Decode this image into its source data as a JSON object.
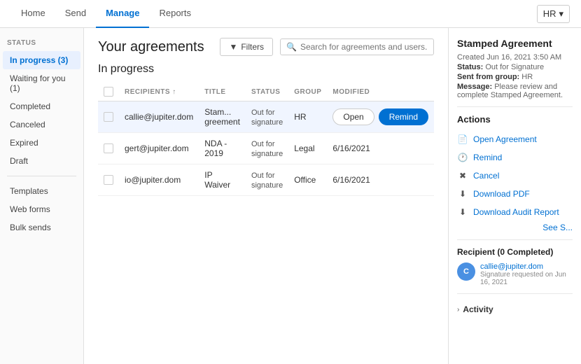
{
  "nav": {
    "items": [
      {
        "label": "Home",
        "active": false
      },
      {
        "label": "Send",
        "active": false
      },
      {
        "label": "Manage",
        "active": true
      },
      {
        "label": "Reports",
        "active": false
      }
    ],
    "user_btn": "HR"
  },
  "sidebar": {
    "status_label": "STATUS",
    "status_items": [
      {
        "label": "In progress (3)",
        "active": true
      },
      {
        "label": "Waiting for you (1)",
        "active": false
      },
      {
        "label": "Completed",
        "active": false
      },
      {
        "label": "Canceled",
        "active": false
      },
      {
        "label": "Expired",
        "active": false
      },
      {
        "label": "Draft",
        "active": false
      }
    ],
    "other_items": [
      {
        "label": "Templates"
      },
      {
        "label": "Web forms"
      },
      {
        "label": "Bulk sends"
      }
    ]
  },
  "content": {
    "page_title": "Your agreements",
    "filter_btn": "Filters",
    "search_placeholder": "Search for agreements and users...",
    "section_title": "In progress",
    "table": {
      "columns": [
        "",
        "RECIPIENTS",
        "TITLE",
        "STATUS",
        "GROUP",
        "MODIFIED"
      ],
      "rows": [
        {
          "recipient": "callie@jupiter.dom",
          "title": "Stam... greement",
          "status": "Out for signature",
          "group": "HR",
          "modified": "",
          "has_actions": true,
          "open_btn": "Open",
          "remind_btn": "Remind",
          "selected": true
        },
        {
          "recipient": "gert@jupiter.dom",
          "title": "NDA - 2019",
          "status": "Out for signature",
          "group": "Legal",
          "modified": "6/16/2021",
          "has_actions": false
        },
        {
          "recipient": "io@jupiter.dom",
          "title": "IP Waiver",
          "status": "Out for signature",
          "group": "Office",
          "modified": "6/16/2021",
          "has_actions": false
        }
      ]
    }
  },
  "right_panel": {
    "agreement_title": "Stamped Agreement",
    "created": "Created Jun 16, 2021 3:50 AM",
    "status_label": "Status:",
    "status_value": "Out for Signature",
    "sent_from_label": "Sent from group:",
    "sent_from_value": "HR",
    "message_label": "Message:",
    "message_value": "Please review and complete Stamped Agreement.",
    "actions_title": "Actions",
    "actions": [
      {
        "label": "Open Agreement",
        "icon": "doc"
      },
      {
        "label": "Remind",
        "icon": "clock"
      },
      {
        "label": "Cancel",
        "icon": "x-circle"
      },
      {
        "label": "Download PDF",
        "icon": "download"
      },
      {
        "label": "Download Audit Report",
        "icon": "download"
      }
    ],
    "see_all": "See S...",
    "recipient_title": "Recipient (0 Completed)",
    "recipient_email": "callie@jupiter.dom",
    "recipient_avatar_initials": "C",
    "recipient_status": "Signature requested on Jun 16, 2021",
    "activity_label": "Activity"
  }
}
